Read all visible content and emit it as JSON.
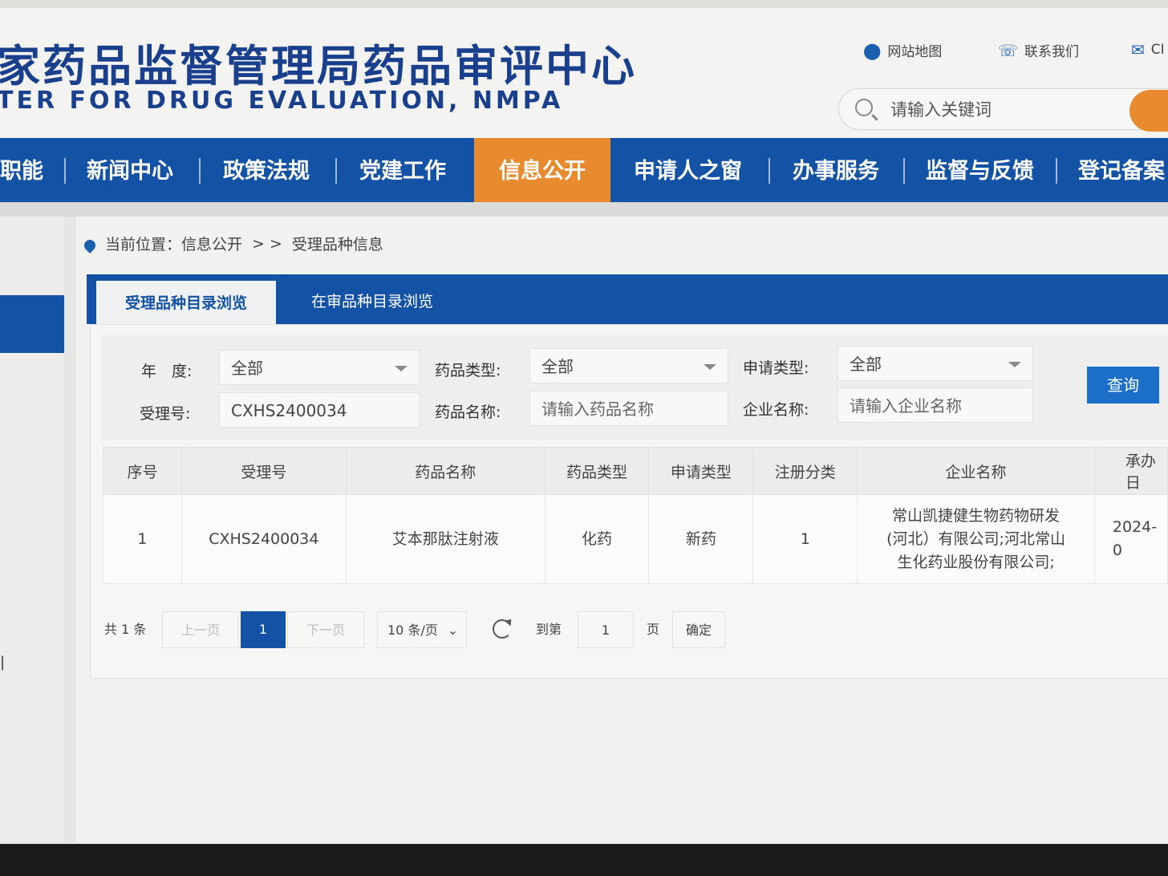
{
  "header": {
    "site_title": "家药品监督管理局药品审评中心",
    "site_subtitle": "TER FOR DRUG EVALUATION, NMPA",
    "links": [
      {
        "label": "网站地图",
        "icon": "location-pin-icon"
      },
      {
        "label": "联系我们",
        "icon": "phone-icon"
      },
      {
        "label": "CI",
        "icon": "mail-icon"
      }
    ],
    "search": {
      "placeholder": "请输入关键词"
    }
  },
  "nav": {
    "items": [
      "职能",
      "新闻中心",
      "政策法规",
      "党建工作",
      "信息公开",
      "申请人之窗",
      "办事服务",
      "监督与反馈",
      "登记备案"
    ],
    "active": "信息公开"
  },
  "breadcrumb": {
    "label": "当前位置：",
    "path": "信息公开",
    "sep": "> >",
    "current": "受理品种信息"
  },
  "tabs": {
    "active": "受理品种目录浏览",
    "other": "在审品种目录浏览"
  },
  "filters": {
    "year": {
      "label": "年　度:",
      "value": "全部"
    },
    "drug_type": {
      "label": "药品类型:",
      "value": "全部"
    },
    "apply_type": {
      "label": "申请类型:",
      "value": "全部"
    },
    "accept_no": {
      "label": "受理号:",
      "value": "CXHS2400034"
    },
    "drug_name": {
      "label": "药品名称:",
      "placeholder": "请输入药品名称"
    },
    "company": {
      "label": "企业名称:",
      "placeholder": "请输入企业名称"
    },
    "query_label": "查询"
  },
  "table": {
    "headers": [
      "序号",
      "受理号",
      "药品名称",
      "药品类型",
      "申请类型",
      "注册分类",
      "企业名称",
      "承办日"
    ],
    "rows": [
      {
        "no": "1",
        "accept_no": "CXHS2400034",
        "drug_name": "艾本那肽注射液",
        "drug_type": "化药",
        "apply_type": "新药",
        "reg_class": "1",
        "company_lines": [
          "常山凯捷健生物药物研发",
          "(河北）有限公司;河北常山",
          "生化药业股份有限公司;"
        ],
        "date": "2024-0"
      }
    ]
  },
  "pager": {
    "total": "共 1 条",
    "prev": "上一页",
    "current": "1",
    "next": "下一页",
    "page_size": "10 条/页",
    "goto_label": "到第",
    "goto_value": "1",
    "page_unit": "页",
    "confirm": "确定"
  }
}
